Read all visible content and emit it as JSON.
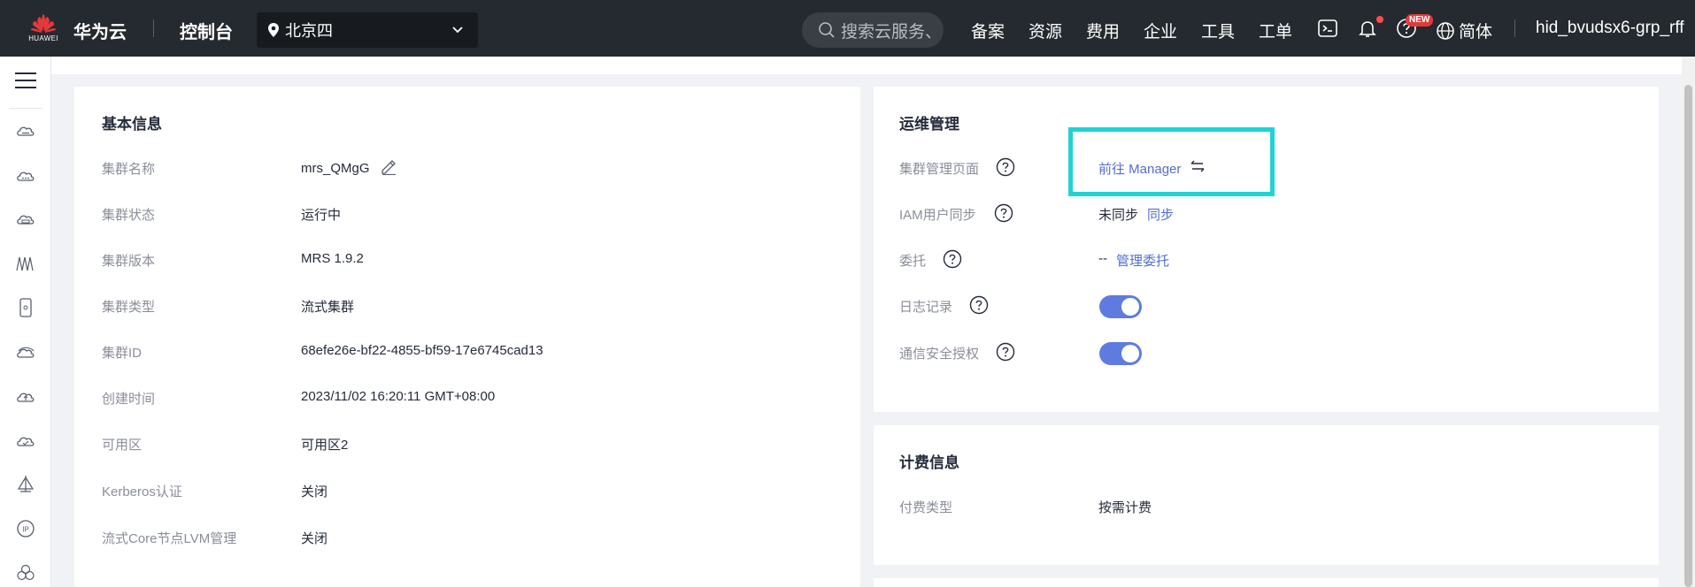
{
  "header": {
    "brand_text": "HUAWEI",
    "product": "华为云",
    "console": "控制台",
    "region": "北京四",
    "search_placeholder": "搜索云服务、",
    "nav": [
      "备案",
      "资源",
      "费用",
      "企业",
      "工具",
      "工单"
    ],
    "new_badge": "NEW",
    "language": "简体",
    "username": "hid_bvudsx6-grp_rff"
  },
  "sidebar": {
    "icons": [
      "cloud-server-icon",
      "cloud-icon",
      "cloud-storage-icon",
      "network-wave-icon",
      "device-icon",
      "cloud-ring-icon",
      "cloud-upload-icon",
      "cloud-check-icon",
      "sail-icon",
      "ip-icon",
      "cluster-icon"
    ]
  },
  "basic_info": {
    "title": "基本信息",
    "rows": [
      {
        "label": "集群名称",
        "value": "mrs_QMgG"
      },
      {
        "label": "集群状态",
        "value": "运行中"
      },
      {
        "label": "集群版本",
        "value": "MRS 1.9.2"
      },
      {
        "label": "集群类型",
        "value": "流式集群"
      },
      {
        "label": "集群ID",
        "value": "68efe26e-bf22-4855-bf59-17e6745cad13"
      },
      {
        "label": "创建时间",
        "value": "2023/11/02 16:20:11 GMT+08:00"
      },
      {
        "label": "可用区",
        "value": "可用区2"
      },
      {
        "label": "Kerberos认证",
        "value": "关闭"
      },
      {
        "label": "流式Core节点LVM管理",
        "value": "关闭"
      }
    ]
  },
  "ops": {
    "title": "运维管理",
    "manager_label": "集群管理页面",
    "manager_link": "前往 Manager",
    "iam_label": "IAM用户同步",
    "iam_status": "未同步",
    "iam_sync": "同步",
    "agency_label": "委托",
    "agency_value": "--",
    "agency_link": "管理委托",
    "log_label": "日志记录",
    "log_enabled": true,
    "comm_label": "通信安全授权",
    "comm_enabled": true
  },
  "billing": {
    "title": "计费信息",
    "pay_label": "付费类型",
    "pay_value": "按需计费"
  },
  "colors": {
    "accent": "#5e7ce0",
    "link": "#526ecc",
    "highlight": "#1ed3d6",
    "topbar": "#252a30"
  }
}
